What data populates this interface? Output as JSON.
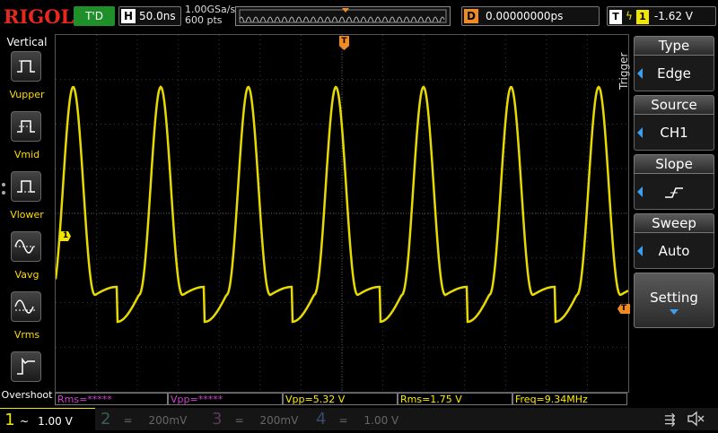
{
  "header": {
    "brand": "RIGOL",
    "run_state": "T'D",
    "timebase_key": "H",
    "timebase_value": "50.0ns",
    "sample_rate": "1.00GSa/s",
    "memory_depth": "600 pts",
    "delay_key": "D",
    "delay_value": "0.00000000ps",
    "trigger_key": "T",
    "trigger_channel": "1",
    "trigger_level": "-1.62 V"
  },
  "left_menu": {
    "title": "Vertical",
    "items": [
      {
        "label": "Vupper",
        "icon": "vupper-icon"
      },
      {
        "label": "Vmid",
        "icon": "vmid-icon"
      },
      {
        "label": "Vlower",
        "icon": "vlower-icon"
      },
      {
        "label": "Vavg",
        "icon": "vavg-icon"
      },
      {
        "label": "Vrms",
        "icon": "vrms-icon"
      },
      {
        "label": "Overshoot",
        "icon": "overshoot-icon"
      }
    ]
  },
  "right_menu": {
    "title": "Trigger",
    "items": [
      {
        "header": "Type",
        "value": "Edge"
      },
      {
        "header": "Source",
        "value": "CH1"
      },
      {
        "header": "Slope",
        "value": ""
      },
      {
        "header": "Sweep",
        "value": "Auto"
      },
      {
        "header": "Setting",
        "value": ""
      }
    ]
  },
  "channel1_marker": "1",
  "trigger_marker": "T",
  "measurements": [
    {
      "text": "Rms=*****",
      "color": "#d040d0"
    },
    {
      "text": "Vpp=*****",
      "color": "#d040d0"
    },
    {
      "text": "Vpp=5.32 V",
      "color": "#ffee00"
    },
    {
      "text": "Rms=1.75 V",
      "color": "#ffee00"
    },
    {
      "text": "Freq=9.34MHz",
      "color": "#ffee00"
    }
  ],
  "channels": [
    {
      "num": "1",
      "coupling": "~",
      "scale": "1.00 V",
      "color": "#f2e600",
      "active": true
    },
    {
      "num": "2",
      "coupling": "=",
      "scale": "200mV",
      "color": "#1fb0a8",
      "active": false
    },
    {
      "num": "3",
      "coupling": "=",
      "scale": "200mV",
      "color": "#c030c0",
      "active": false
    },
    {
      "num": "4",
      "coupling": "=",
      "scale": "1.00 V",
      "color": "#3a70e0",
      "active": false
    }
  ],
  "status_icons": [
    "usb-icon",
    "mute-speaker-icon"
  ],
  "colors": {
    "trace": "#f2e600",
    "brand": "#e8281e",
    "accent": "#3a9fef",
    "trigger": "#f08a24"
  }
}
